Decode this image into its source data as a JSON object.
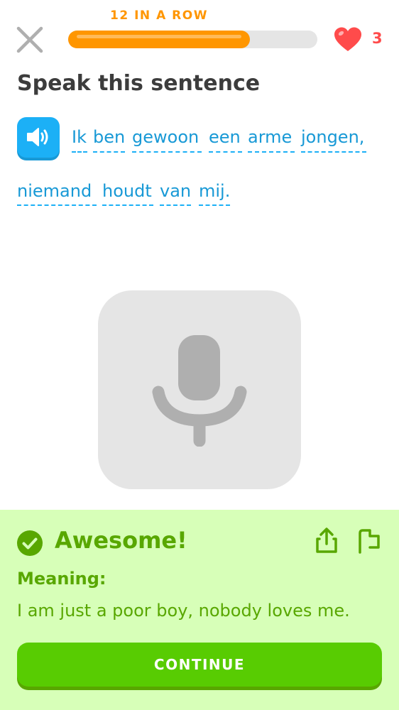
{
  "header": {
    "streak_label": "12 IN A ROW",
    "progress_fraction": 0.73,
    "hearts_count": "3"
  },
  "prompt": {
    "title": "Speak this sentence",
    "sentence_words": [
      "Ik",
      "ben",
      "gewoon",
      "een",
      "arme",
      "jongen,",
      "niemand",
      "houdt",
      "van",
      "mij."
    ]
  },
  "icons": {
    "close": "close-icon",
    "heart": "heart-icon",
    "speaker": "speaker-icon",
    "microphone": "microphone-icon",
    "check": "check-circle-icon",
    "share": "share-icon",
    "flag": "flag-icon"
  },
  "colors": {
    "streak_orange": "#ff9600",
    "heart_red": "#ff4b4b",
    "word_blue": "#1899d6",
    "success_green": "#58a700",
    "button_green": "#58cc02",
    "panel_bg": "#d7ffb8"
  },
  "feedback": {
    "title": "Awesome!",
    "meaning_label": "Meaning:",
    "meaning_text": "I am just a poor boy, nobody loves me.",
    "continue_label": "CONTINUE"
  }
}
